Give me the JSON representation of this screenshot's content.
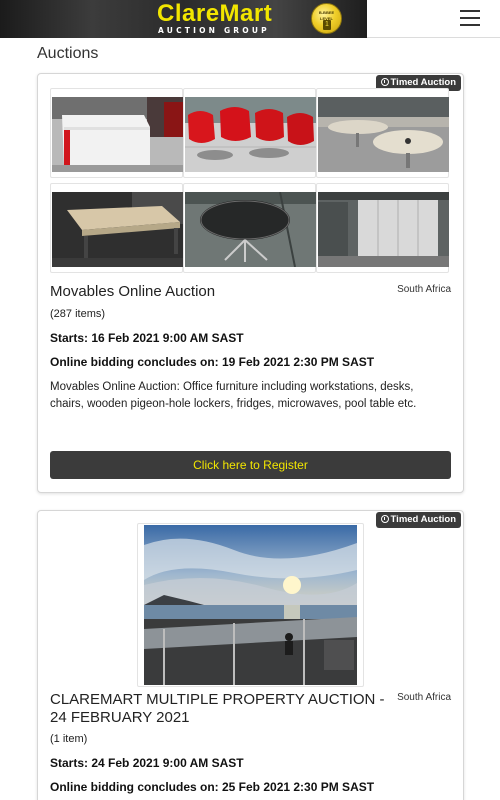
{
  "header": {
    "brand": "ClareMart",
    "brand_sub": "AUCTION GROUP",
    "seal_line1": "B-BBEE",
    "seal_line2": "LEVEL",
    "seal_level": "1",
    "menu_icon": "hamburger-menu-icon"
  },
  "page": {
    "title": "Auctions"
  },
  "auctions": [
    {
      "badge": "Timed Auction",
      "title": "Movables Online Auction",
      "country": "South Africa",
      "items": "(287 items)",
      "starts": "Starts: 16 Feb 2021 9:00 AM SAST",
      "concludes": "Online bidding concludes on: 19 Feb 2021 2:30 PM SAST",
      "description": "Movables Online Auction: Office furniture including workstations, desks, chairs, wooden pigeon-hole lockers, fridges, microwaves, pool table etc.",
      "register_label": "Click here to Register"
    },
    {
      "badge": "Timed Auction",
      "title": "CLAREMART MULTIPLE PROPERTY AUCTION - 24 FEBRUARY 2021",
      "country": "South Africa",
      "items": "(1 item)",
      "starts": "Starts: 24 Feb 2021 9:00 AM SAST",
      "concludes": "Online bidding concludes on: 25 Feb 2021 2:30 PM SAST"
    }
  ],
  "colors": {
    "accent_yellow": "#f2e600",
    "button_dark": "#3b3b3b",
    "badge_dark": "#3b3b3b"
  }
}
